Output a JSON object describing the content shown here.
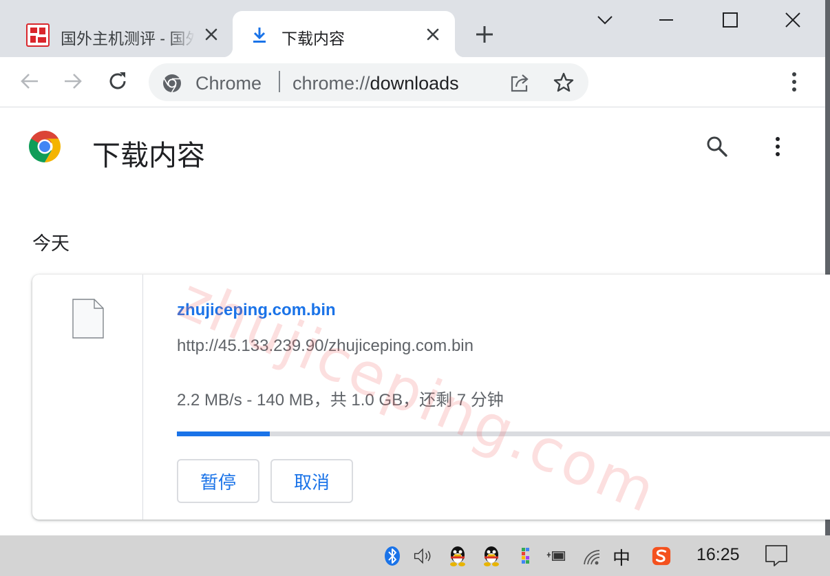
{
  "tabs": [
    {
      "title": "国外主机测评 - 国外主机测评",
      "active": false,
      "favicon": "site-logo-icon"
    },
    {
      "title": "下载内容",
      "active": true,
      "favicon": "download-icon"
    }
  ],
  "toolbar": {
    "omnibox_label": "Chrome",
    "url_scheme": "chrome://",
    "url_host": "downloads"
  },
  "page": {
    "title": "下载内容",
    "section_date": "今天"
  },
  "download": {
    "file_name": "zhujiceping.com.bin",
    "url": "http://45.133.239.90/zhujiceping.com.bin",
    "status": "2.2 MB/s - 140 MB，共 1.0 GB，还剩 7 分钟",
    "progress_fraction": 0.14,
    "pause_label": "暂停",
    "cancel_label": "取消"
  },
  "watermark": "zhujiceping.com",
  "taskbar": {
    "ime": "中",
    "clock": "16:25"
  },
  "colors": {
    "accent": "#1a73e8",
    "tabstrip": "#dee1e6",
    "taskbar": "#d4d4d4"
  }
}
